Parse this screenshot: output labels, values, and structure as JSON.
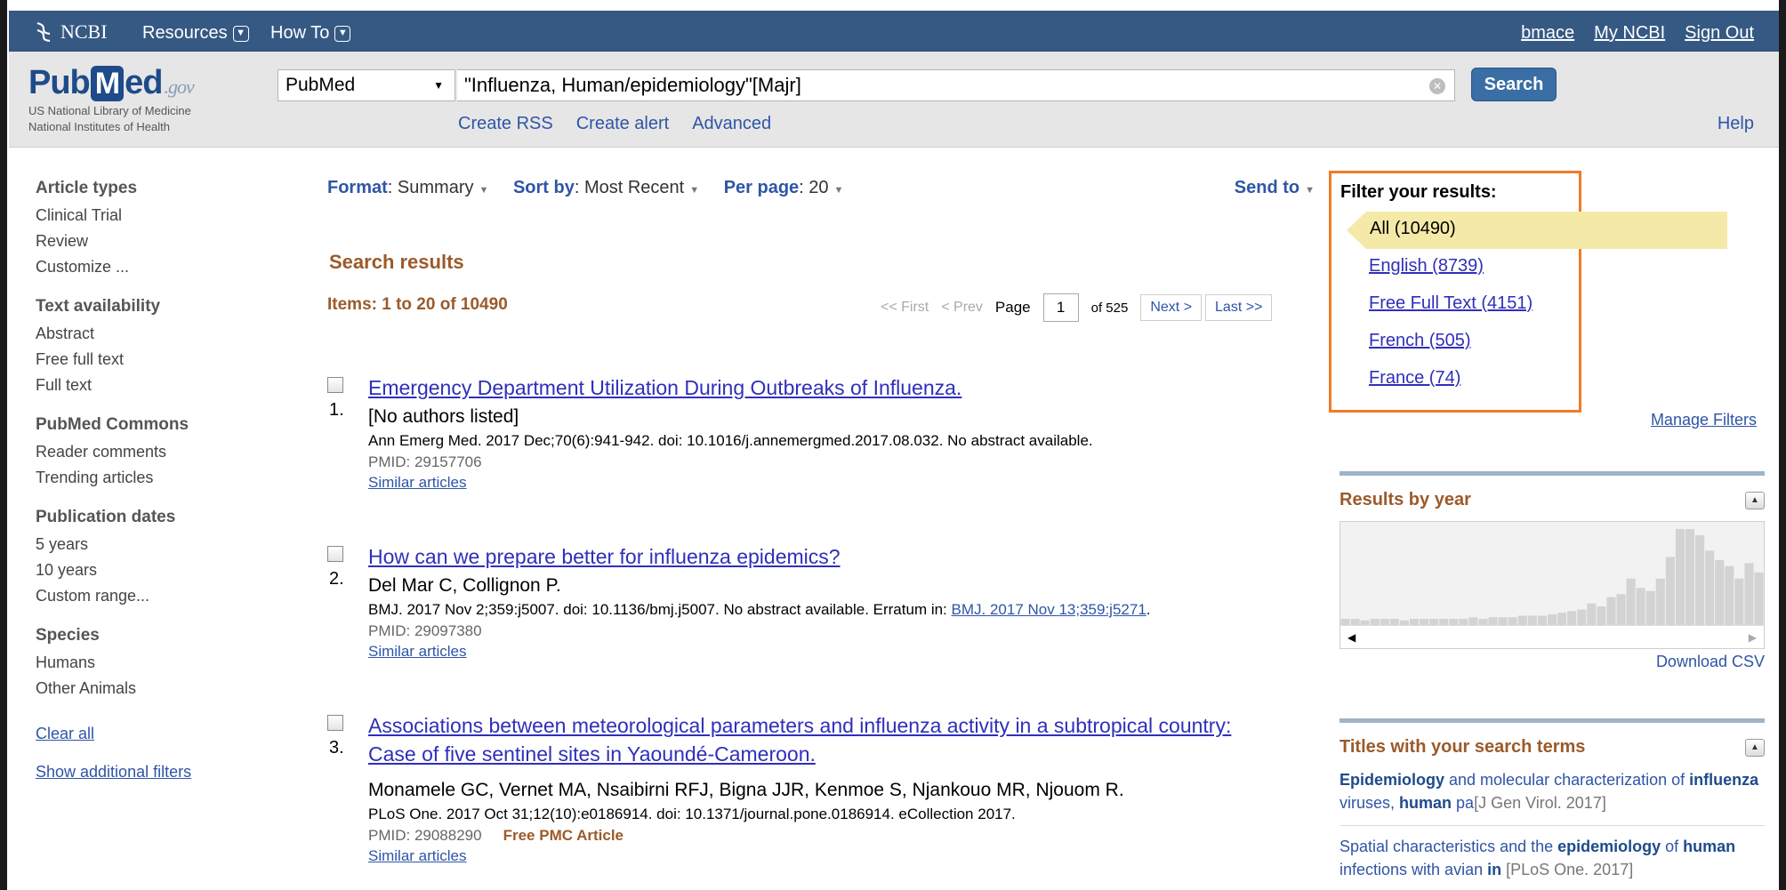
{
  "ncbi_bar": {
    "logo": "NCBI",
    "nav": [
      {
        "label": "Resources"
      },
      {
        "label": "How To"
      }
    ],
    "user": {
      "username": "bmace",
      "my_ncbi": "My NCBI",
      "sign_out": "Sign Out"
    }
  },
  "header": {
    "logo_pub": "Pub",
    "logo_m": "M",
    "logo_ed": "ed",
    "logo_gov": ".gov",
    "org_line1": "US National Library of Medicine",
    "org_line2": "National Institutes of Health",
    "database": "PubMed",
    "query": "\"Influenza, Human/epidemiology\"[Majr]",
    "search_button": "Search",
    "links": [
      "Create RSS",
      "Create alert",
      "Advanced"
    ],
    "help": "Help"
  },
  "sidebar": {
    "groups": [
      {
        "heading": "Article types",
        "items": [
          "Clinical Trial",
          "Review",
          "Customize ..."
        ]
      },
      {
        "heading": "Text availability",
        "items": [
          "Abstract",
          "Free full text",
          "Full text"
        ]
      },
      {
        "heading": "PubMed Commons",
        "items": [
          "Reader comments",
          "Trending articles"
        ]
      },
      {
        "heading": "Publication dates",
        "items": [
          "5 years",
          "10 years",
          "Custom range..."
        ]
      },
      {
        "heading": "Species",
        "items": [
          "Humans",
          "Other Animals"
        ]
      }
    ],
    "clear_all": "Clear all",
    "show_additional": "Show additional filters"
  },
  "toolbar": {
    "format_label": "Format",
    "format_value": ": Summary",
    "sort_label": "Sort by",
    "sort_value": ": Most Recent",
    "perpage_label": "Per page",
    "perpage_value": ": 20",
    "send_to": "Send to"
  },
  "results": {
    "heading": "Search results",
    "items_summary": "Items: 1 to 20 of 10490",
    "pager": {
      "first": "<< First",
      "prev": "< Prev",
      "page_label": "Page",
      "page": "1",
      "of": "of 525",
      "next": "Next >",
      "last": "Last >>"
    },
    "list": [
      {
        "num": "1.",
        "title": "Emergency Department Utilization During Outbreaks of Influenza.",
        "authors": "[No authors listed]",
        "citation": "Ann Emerg Med. 2017 Dec;70(6):941-942. doi: 10.1016/j.annemergmed.2017.08.032. No abstract available.",
        "pmid": "PMID: 29157706",
        "similar": "Similar articles"
      },
      {
        "num": "2.",
        "title": "How can we prepare better for influenza epidemics?",
        "authors": "Del Mar C, Collignon P.",
        "citation": "BMJ. 2017 Nov 2;359:j5007. doi: 10.1136/bmj.j5007. No abstract available. Erratum in: ",
        "erratum_link": "BMJ. 2017 Nov 13;359:j5271",
        "citation_end": ".",
        "pmid": "PMID: 29097380",
        "similar": "Similar articles"
      },
      {
        "num": "3.",
        "title": "Associations between meteorological parameters and influenza activity in a subtropical country: Case of five sentinel sites in Yaoundé-Cameroon.",
        "authors": "Monamele GC, Vernet MA, Nsaibirni RFJ, Bigna JJR, Kenmoe S, Njankouo MR, Njouom R.",
        "citation": "PLoS One. 2017 Oct 31;12(10):e0186914. doi: 10.1371/journal.pone.0186914. eCollection 2017.",
        "pmid": "PMID: 29088290",
        "free_pmc": "Free PMC Article",
        "similar": "Similar articles"
      }
    ]
  },
  "filters": {
    "title": "Filter your results:",
    "all": "All (10490)",
    "links": [
      "English (8739)",
      "Free Full Text (4151)",
      "French (505)",
      "France (74)"
    ],
    "manage": "Manage Filters"
  },
  "results_by_year": {
    "title": "Results by year",
    "download": "Download CSV",
    "bars": [
      4,
      4,
      3,
      4,
      4,
      4,
      3,
      4,
      4,
      4,
      4,
      4,
      4,
      5,
      4,
      5,
      5,
      5,
      6,
      6,
      6,
      7,
      8,
      9,
      10,
      14,
      12,
      18,
      20,
      30,
      24,
      22,
      30,
      44,
      62,
      62,
      58,
      48,
      42,
      38,
      30,
      40,
      34
    ]
  },
  "titles_with_terms": {
    "title": "Titles with your search terms",
    "items": [
      {
        "w1": "Epidemiology",
        "t1": " and molecular characterization of ",
        "w2": "influenza",
        "t2": " viruses, ",
        "w3": "human",
        "t3": " pa",
        "src": "[J Gen Virol. 2017]"
      },
      {
        "w1": "Spatial characteristics and the ",
        "t1": "",
        "w2": "epidemiology",
        "t2": " of ",
        "w3": "human",
        "t3": " infections with avian ",
        "w4": "in",
        "src": "[PLoS One. 2017]"
      }
    ]
  },
  "colors": {
    "header_blue": "#365984",
    "result_link": "#2f2fbb",
    "brown": "#9c5a2a",
    "filter_highlight": "#f07a2a"
  }
}
